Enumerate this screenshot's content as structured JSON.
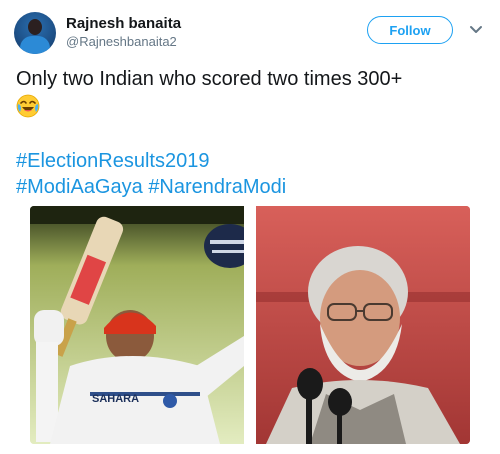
{
  "user": {
    "name": "Rajnesh banaita",
    "handle": "@Rajneshbanaita2",
    "follow_label": "Follow"
  },
  "tweet": {
    "text": "Only two Indian who scored two times 300+",
    "emoji": "face-with-tears-of-joy",
    "hashtags_line1": [
      "#ElectionResults2019"
    ],
    "hashtags_line2": [
      "#ModiAaGaya",
      "#NarendraModi"
    ]
  },
  "media": {
    "left_image": {
      "subject": "cricketer-raising-bat",
      "jersey_text": "SAHARA"
    },
    "right_image": {
      "subject": "man-speaking-at-microphones"
    }
  },
  "colors": {
    "link": "#1b95e0",
    "follow_border": "#1da1f2",
    "handle": "#657786",
    "text": "#14171a"
  }
}
